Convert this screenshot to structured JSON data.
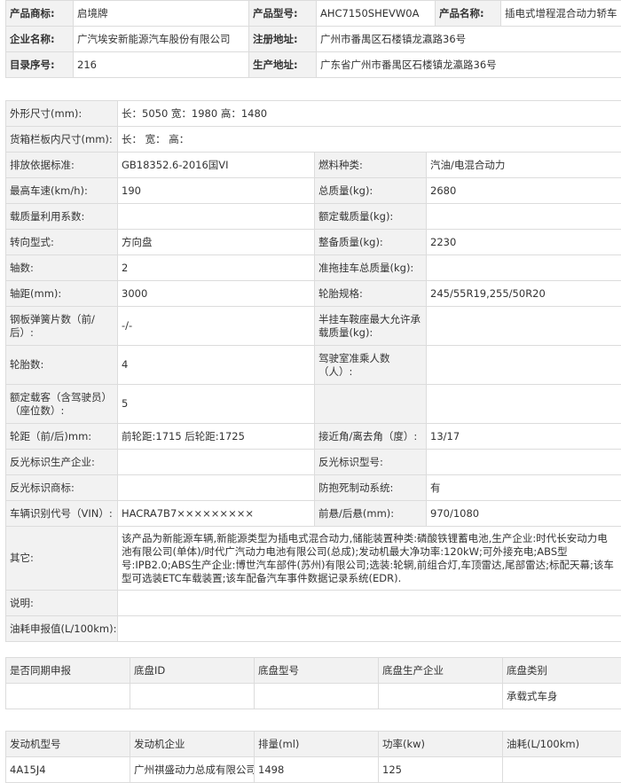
{
  "top": {
    "rows": [
      [
        {
          "l": "产品商标:",
          "v": "启境牌"
        },
        {
          "l": "产品型号:",
          "v": "AHC7150SHEVW0A"
        },
        {
          "l": "产品名称:",
          "v": "插电式增程混合动力轿车"
        }
      ],
      [
        {
          "l": "企业名称:",
          "v": "广汽埃安新能源汽车股份有限公司"
        },
        {
          "l": "注册地址:",
          "v": "广州市番禺区石楼镇龙瀛路36号"
        }
      ],
      [
        {
          "l": "目录序号:",
          "v": "216"
        },
        {
          "l": "生产地址:",
          "v": "广东省广州市番禺区石楼镇龙瀛路36号"
        }
      ]
    ]
  },
  "specs": {
    "dimensions_label": "外形尺寸(mm):",
    "dimensions_value": "长：5050 宽：1980 高：1480",
    "cargo_label": "货箱栏板内尺寸(mm):",
    "cargo_value": "长：  宽：  高：",
    "pairs": [
      {
        "l1": "排放依据标准:",
        "v1": "GB18352.6-2016国VI",
        "l2": "燃料种类:",
        "v2": "汽油/电混合动力"
      },
      {
        "l1": "最高车速(km/h):",
        "v1": "190",
        "l2": "总质量(kg):",
        "v2": "2680"
      },
      {
        "l1": "载质量利用系数:",
        "v1": "",
        "l2": "额定载质量(kg):",
        "v2": ""
      },
      {
        "l1": "转向型式:",
        "v1": "方向盘",
        "l2": "整备质量(kg):",
        "v2": "2230"
      },
      {
        "l1": "轴数:",
        "v1": "2",
        "l2": "准拖挂车总质量(kg):",
        "v2": ""
      },
      {
        "l1": "轴距(mm):",
        "v1": "3000",
        "l2": "轮胎规格:",
        "v2": "245/55R19,255/50R20"
      },
      {
        "l1": "钢板弹簧片数（前/后）:",
        "v1": "-/-",
        "l2": "半挂车鞍座最大允许承载质量(kg):",
        "v2": ""
      },
      {
        "l1": "轮胎数:",
        "v1": "4",
        "l2": "驾驶室准乘人数（人）:",
        "v2": ""
      },
      {
        "l1": "额定载客（含驾驶员）（座位数）:",
        "v1": "5",
        "l2": "",
        "v2": ""
      },
      {
        "l1": "轮距（前/后)mm:",
        "v1": "前轮距:1715 后轮距:1725",
        "l2": "接近角/离去角（度）:",
        "v2": "13/17"
      },
      {
        "l1": "反光标识生产企业:",
        "v1": "",
        "l2": "反光标识型号:",
        "v2": ""
      },
      {
        "l1": "反光标识商标:",
        "v1": "",
        "l2": "防抱死制动系统:",
        "v2": "有"
      },
      {
        "l1": "车辆识别代号（VIN）:",
        "v1": "HACRA7B7×××××××××",
        "l2": "前悬/后悬(mm):",
        "v2": "970/1080"
      }
    ],
    "other_label": "其它:",
    "other_value": "该产品为新能源车辆,新能源类型为插电式混合动力,储能装置种类:磷酸铁锂蓄电池,生产企业:时代长安动力电池有限公司(单体)/时代广汽动力电池有限公司(总成);发动机最大净功率:120kW;可外接充电;ABS型号:IPB2.0;ABS生产企业:博世汽车部件(苏州)有限公司;选装:轮辋,前组合灯,车顶雷达,尾部雷达;标配天幕;该车型可选装ETC车载装置;该车配备汽车事件数据记录系统(EDR).",
    "note_label": "说明:",
    "note_value": "",
    "fuel_label": "油耗申报值(L/100km):",
    "fuel_value": ""
  },
  "chassis": {
    "headers": [
      "是否同期申报",
      "底盘ID",
      "底盘型号",
      "底盘生产企业",
      "底盘类别"
    ],
    "row": [
      "",
      "",
      "",
      "",
      "承载式车身"
    ]
  },
  "engine": {
    "headers": [
      "发动机型号",
      "发动机企业",
      "排量(ml)",
      "功率(kw)",
      "油耗(L/100km)"
    ],
    "row": [
      "4A15J4",
      "广州祺盛动力总成有限公司",
      "1498",
      "125",
      ""
    ]
  }
}
